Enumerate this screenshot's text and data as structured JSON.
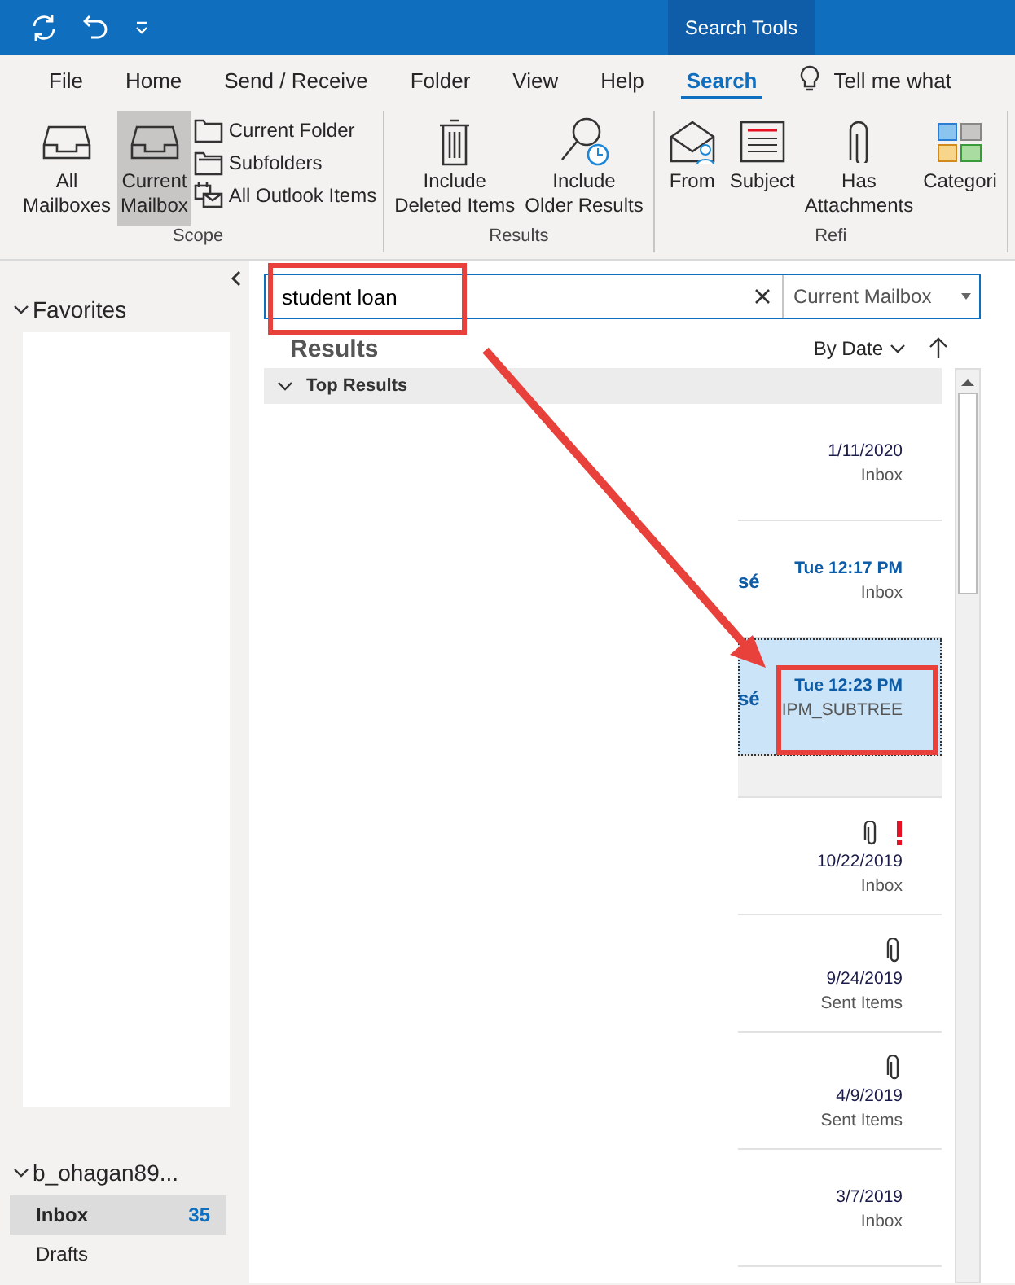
{
  "title_bar": {
    "context_tab": "Search Tools"
  },
  "tabs": [
    {
      "label": "File",
      "selected": false
    },
    {
      "label": "Home",
      "selected": false
    },
    {
      "label": "Send / Receive",
      "selected": false
    },
    {
      "label": "Folder",
      "selected": false
    },
    {
      "label": "View",
      "selected": false
    },
    {
      "label": "Help",
      "selected": false
    },
    {
      "label": "Search",
      "selected": true
    }
  ],
  "tell_me": "Tell me what",
  "ribbon": {
    "groups": [
      {
        "label": "Scope",
        "items": [
          {
            "kind": "large",
            "lines": [
              "All",
              "Mailboxes"
            ],
            "selected": false
          },
          {
            "kind": "large",
            "lines": [
              "Current",
              "Mailbox"
            ],
            "selected": true
          },
          {
            "kind": "stack",
            "entries": [
              {
                "label": "Current Folder"
              },
              {
                "label": "Subfolders"
              },
              {
                "label": "All Outlook Items"
              }
            ]
          }
        ]
      },
      {
        "label": "Results",
        "items": [
          {
            "kind": "large",
            "lines": [
              "Include",
              "Deleted Items"
            ],
            "selected": false
          },
          {
            "kind": "large",
            "lines": [
              "Include",
              "Older Results"
            ],
            "selected": false
          }
        ]
      },
      {
        "label": "Refi",
        "items": [
          {
            "kind": "large",
            "lines": [
              "From"
            ],
            "selected": false
          },
          {
            "kind": "large",
            "lines": [
              "Subject"
            ],
            "selected": false
          },
          {
            "kind": "large",
            "lines": [
              "Has",
              "Attachments"
            ],
            "selected": false
          },
          {
            "kind": "large",
            "lines": [
              "Categori"
            ],
            "selected": false
          }
        ]
      }
    ]
  },
  "sidebar": {
    "favorites": "Favorites",
    "account": "b_ohagan89...",
    "folders": [
      {
        "label": "Inbox",
        "count": "35",
        "selected": true
      },
      {
        "label": "Drafts",
        "selected": false
      }
    ]
  },
  "search": {
    "value": "student loan",
    "scope": "Current Mailbox"
  },
  "results": {
    "title": "Results",
    "sort": "By Date",
    "group": "Top Results",
    "items": [
      {
        "kind": "message",
        "date": "1/11/2020",
        "folder": "Inbox",
        "unread": false,
        "selected": false,
        "attachment": false,
        "important": false
      },
      {
        "kind": "message",
        "sender": "sé",
        "date": "Tue 12:17 PM",
        "folder": "Inbox",
        "unread": true,
        "selected": false,
        "attachment": false,
        "important": false
      },
      {
        "kind": "message",
        "sender": "sé",
        "date": "Tue 12:23 PM",
        "folder": "IPM_SUBTREE",
        "unread": true,
        "selected": true,
        "attachment": false,
        "important": false
      },
      {
        "kind": "group_header"
      },
      {
        "kind": "message",
        "date": "10/22/2019",
        "folder": "Inbox",
        "unread": false,
        "selected": false,
        "attachment": true,
        "important": true
      },
      {
        "kind": "message",
        "date": "9/24/2019",
        "folder": "Sent Items",
        "unread": false,
        "selected": false,
        "attachment": true,
        "important": false
      },
      {
        "kind": "message",
        "date": "4/9/2019",
        "folder": "Sent Items",
        "unread": false,
        "selected": false,
        "attachment": true,
        "important": false
      },
      {
        "kind": "message",
        "date": "3/7/2019",
        "folder": "Inbox",
        "unread": false,
        "selected": false,
        "attachment": false,
        "important": false
      }
    ]
  }
}
